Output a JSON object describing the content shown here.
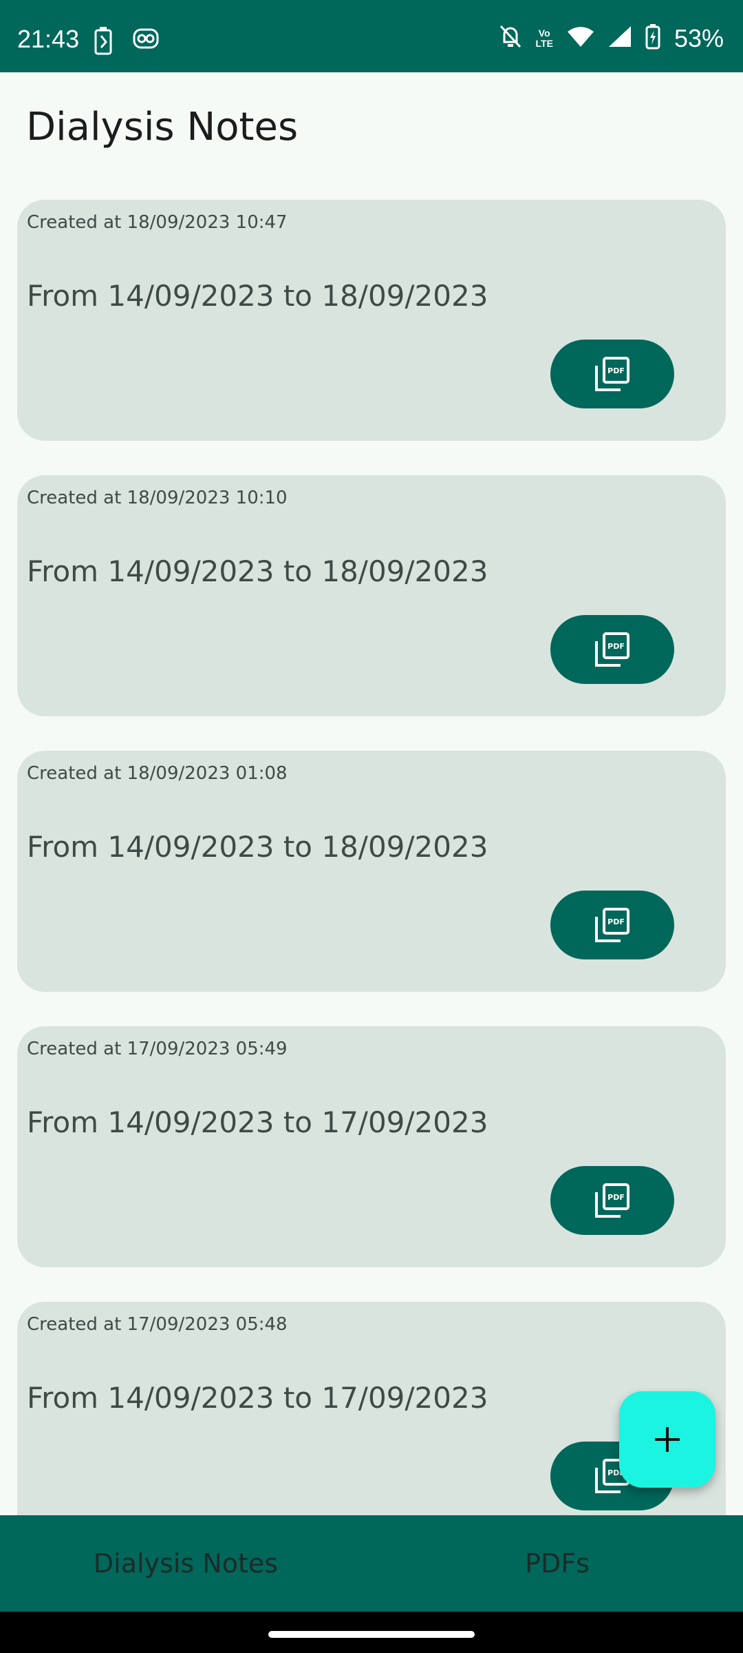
{
  "status_bar": {
    "time": "21:43",
    "battery_pct": "53%",
    "volte_label_top": "Vo",
    "volte_label_bottom": "LTE",
    "icons": [
      "battery-saver-icon",
      "face-icon",
      "bell-off-icon",
      "volte-icon",
      "wifi-icon",
      "signal-icon",
      "battery-icon"
    ]
  },
  "app": {
    "title": "Dialysis Notes"
  },
  "notes": [
    {
      "created": "Created at 18/09/2023 10:47",
      "range": "From 14/09/2023 to 18/09/2023"
    },
    {
      "created": "Created at 18/09/2023 10:10",
      "range": "From 14/09/2023 to 18/09/2023"
    },
    {
      "created": "Created at 18/09/2023 01:08",
      "range": "From 14/09/2023 to 18/09/2023"
    },
    {
      "created": "Created at 17/09/2023 05:49",
      "range": "From 14/09/2023 to 17/09/2023"
    },
    {
      "created": "Created at 17/09/2023 05:48",
      "range": "From 14/09/2023 to 17/09/2023"
    }
  ],
  "pdf_icon_label": "PDF",
  "fab": {
    "icon": "plus-icon"
  },
  "bottom_nav": {
    "tabs": [
      {
        "label": "Dialysis Notes"
      },
      {
        "label": "PDFs"
      }
    ]
  },
  "colors": {
    "primary": "#00675b",
    "card_bg": "#dae4df",
    "fab": "#1cf4e2",
    "background": "#f6faf7"
  }
}
